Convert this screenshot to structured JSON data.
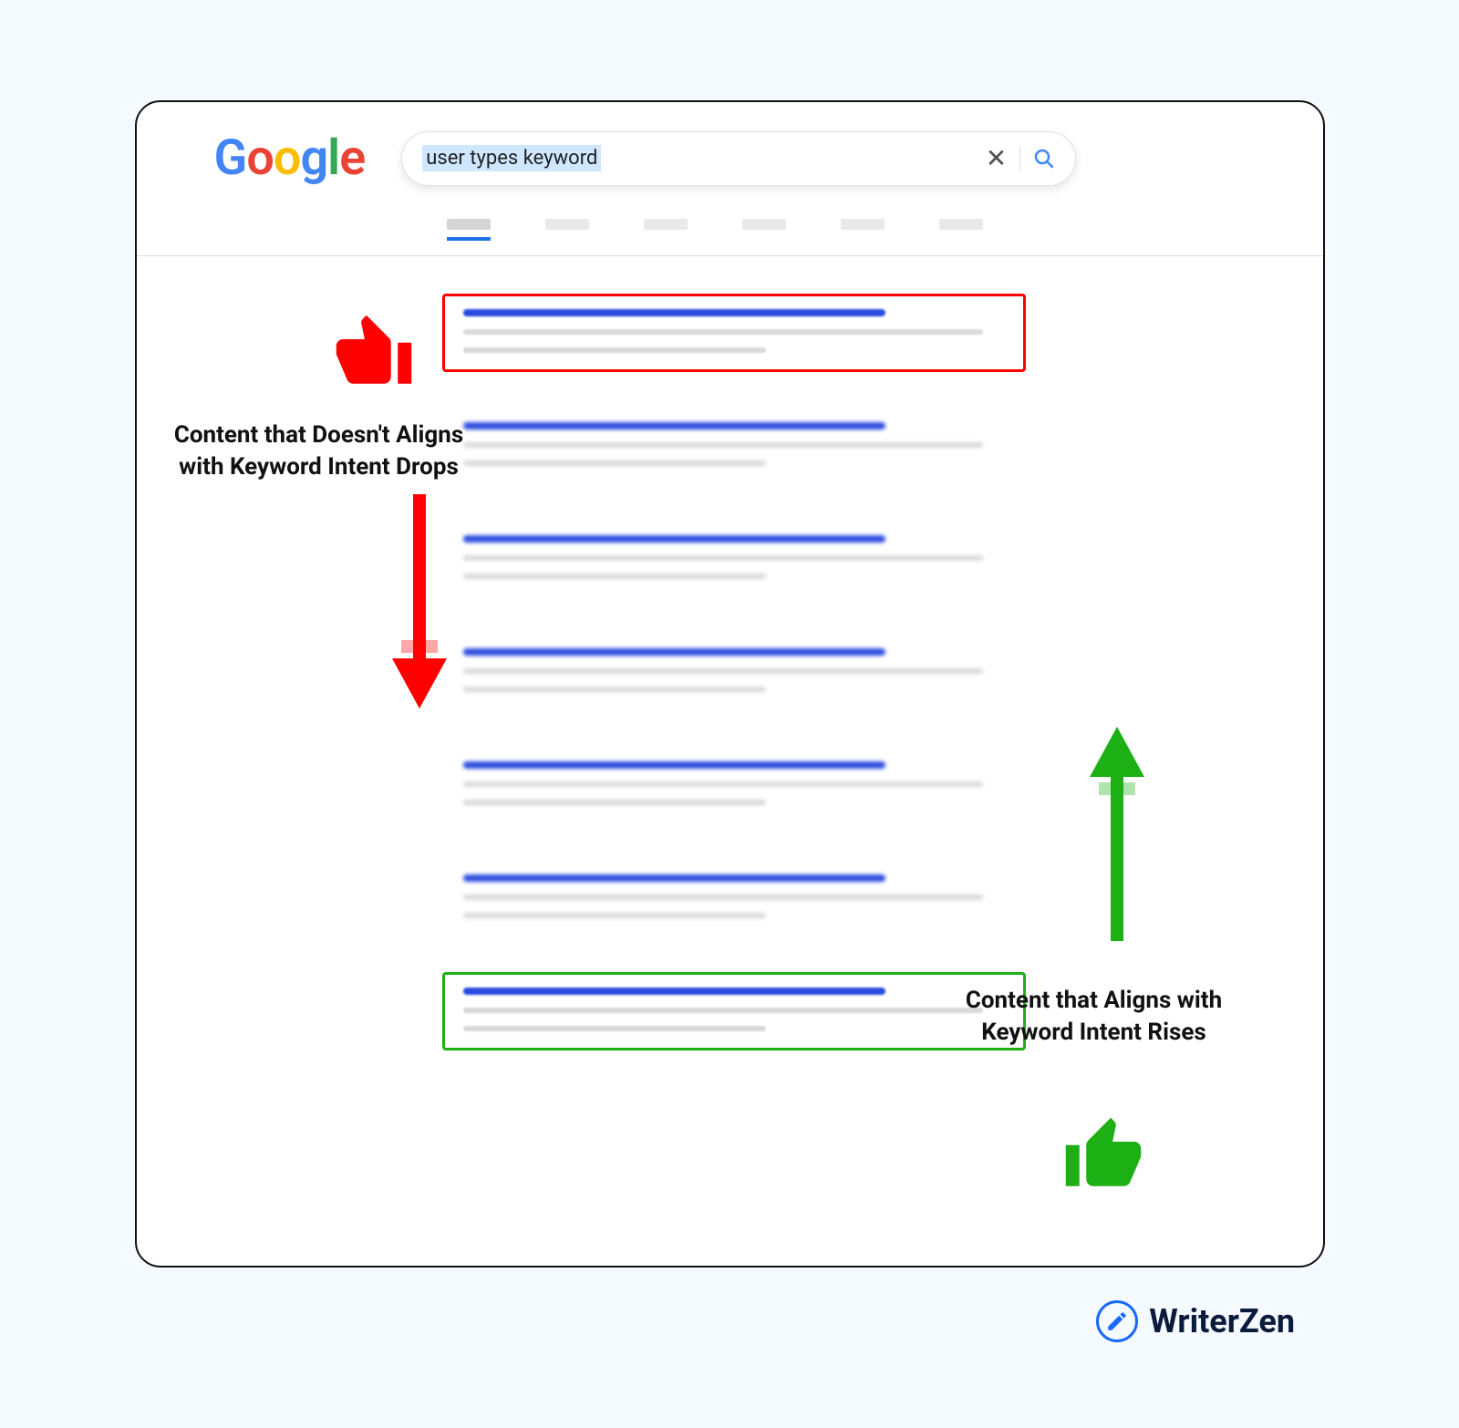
{
  "logo_letters": [
    "G",
    "o",
    "o",
    "g",
    "l",
    "e"
  ],
  "search": {
    "query": "user types keyword"
  },
  "annotations": {
    "bad_label_line1": "Content that Doesn't Aligns",
    "bad_label_line2": "with Keyword Intent Drops",
    "good_label_line1": "Content that Aligns with",
    "good_label_line2": "Keyword Intent Rises"
  },
  "brand": {
    "name": "WriterZen"
  }
}
